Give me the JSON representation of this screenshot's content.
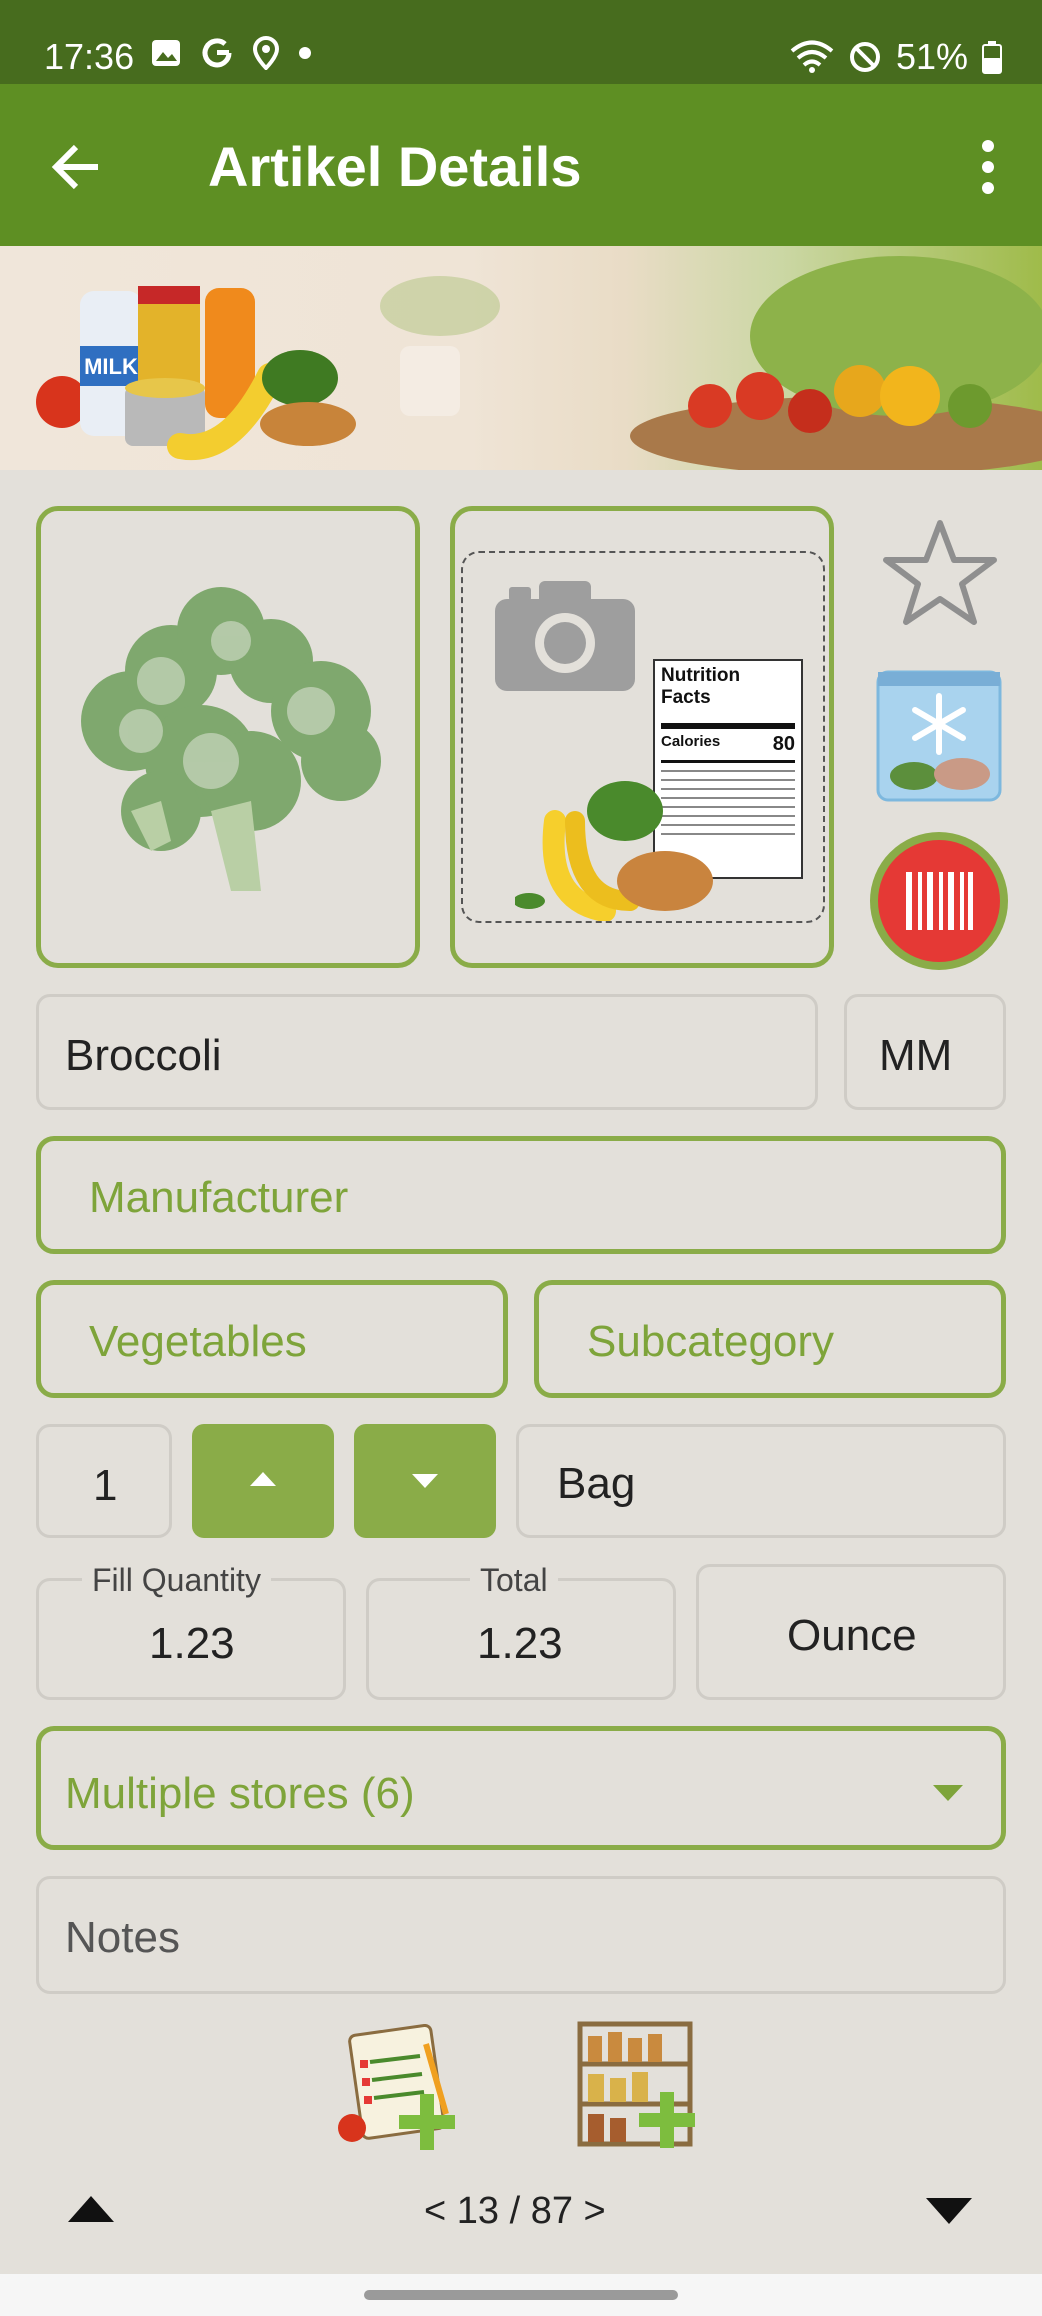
{
  "status_bar": {
    "time": "17:36",
    "battery": "51%"
  },
  "app_bar": {
    "title": "Artikel Details"
  },
  "item": {
    "name": "Broccoli",
    "unit_short": "MM",
    "manufacturer_placeholder": "Manufacturer",
    "category": "Vegetables",
    "subcategory_placeholder": "Subcategory",
    "quantity": "1",
    "package_unit": "Bag",
    "fill_quantity_label": "Fill Quantity",
    "fill_quantity": "1.23",
    "total_label": "Total",
    "total": "1.23",
    "measure_unit": "Ounce",
    "stores": "Multiple stores (6)",
    "notes_placeholder": "Notes"
  },
  "nutrition_label": {
    "title": "Nutrition Facts",
    "calories_label": "Calories",
    "calories_value": "80"
  },
  "banner": {
    "milk_label": "MILK"
  },
  "pager": {
    "text": "< 13 / 87 >"
  },
  "icons": {
    "back": "arrow-left-icon",
    "more": "more-vert-icon",
    "favorite": "star-outline-icon",
    "freezer": "freezer-bag-icon",
    "barcode": "barcode-icon",
    "camera": "camera-icon",
    "add_to_list": "add-to-shopping-list-icon",
    "add_to_pantry": "add-to-pantry-icon"
  },
  "colors": {
    "status_bar": "#476c1e",
    "app_bar": "#5e8f23",
    "accent_green": "#8aac48",
    "background": "#e3e0da",
    "barcode_red": "#e53935"
  }
}
